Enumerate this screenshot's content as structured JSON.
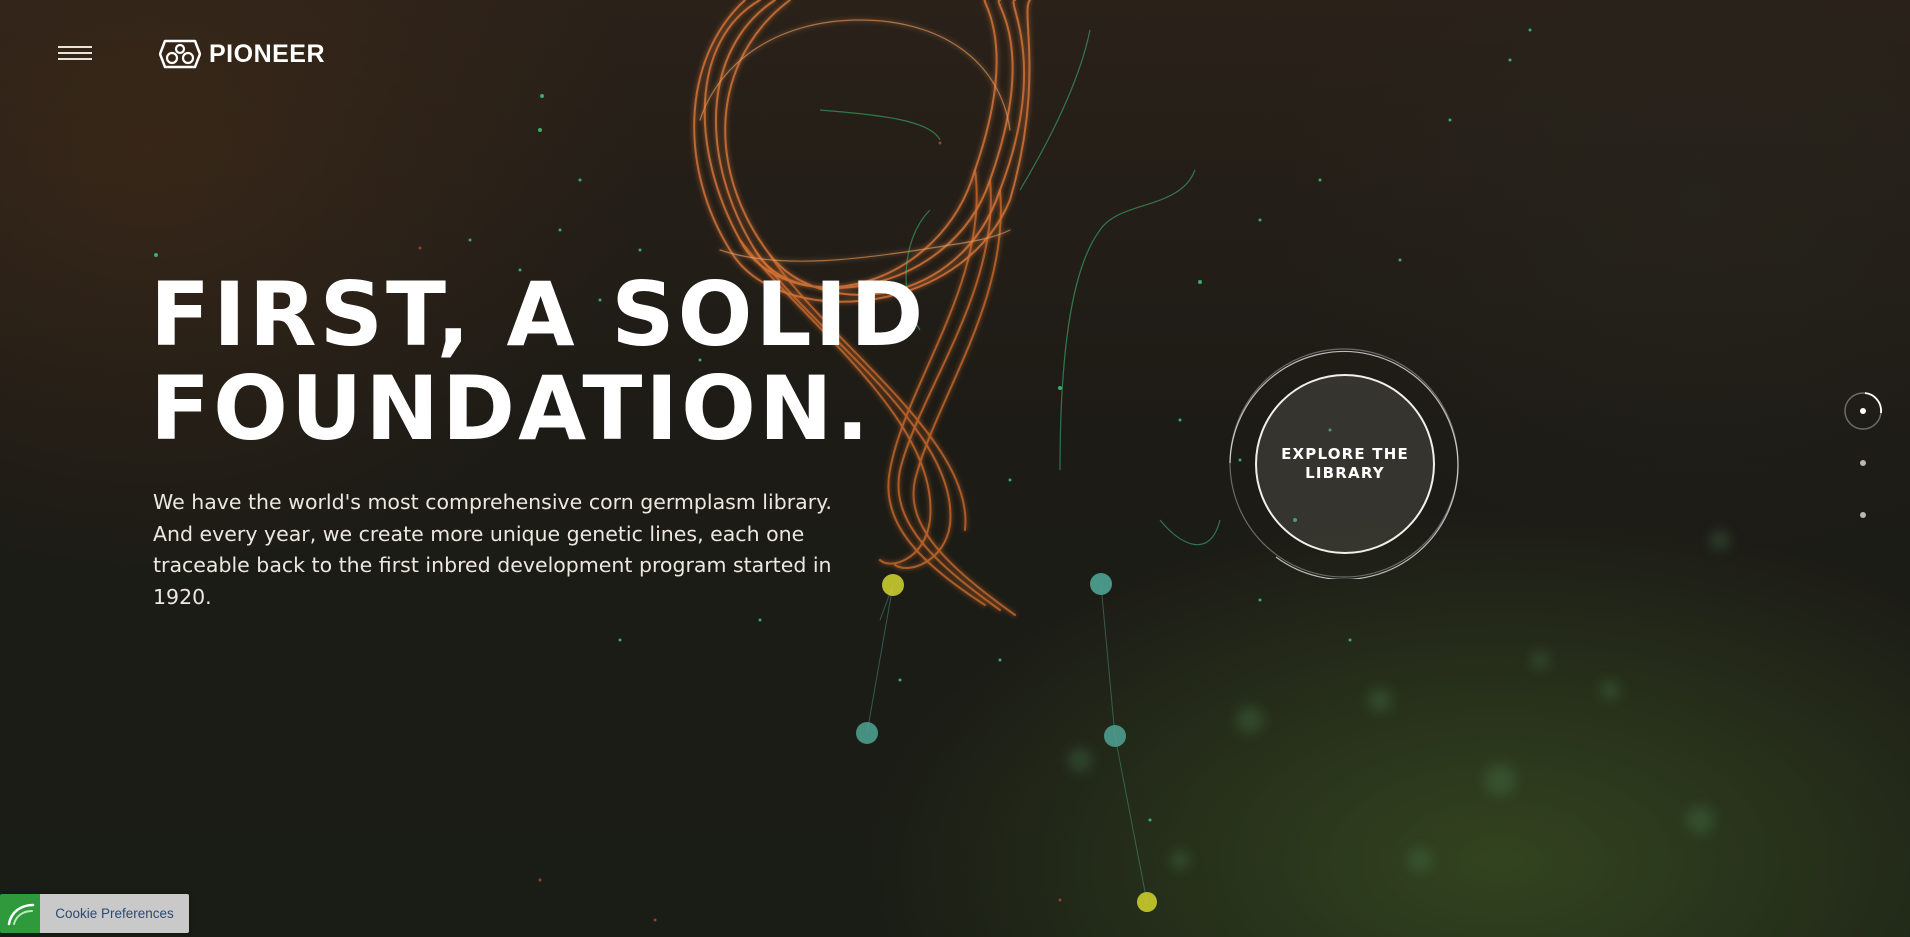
{
  "header": {
    "menu_icon": "hamburger-menu-icon",
    "logo_text": "PIONEER",
    "logo_icon": "pioneer-emblem-icon"
  },
  "hero": {
    "headline_line1": "FIRST, A SOLID",
    "headline_line2": "FOUNDATION.",
    "body": "We have the world's most comprehensive corn germplasm library. And every year, we create more unique genetic lines, each one traceable back to the first inbred development program started in 1920."
  },
  "cta": {
    "explore_label": "EXPLORE THE LIBRARY"
  },
  "pager": {
    "total": 3,
    "active_index": 0
  },
  "cookie": {
    "label": "Cookie Preferences",
    "icon": "cookie-leaf-icon"
  },
  "colors": {
    "accent_orange": "#e8894a",
    "accent_green": "#3fbf74",
    "node_yellow": "#c9cc2e",
    "node_teal": "#4fa394",
    "cookie_green": "#2e9a3c"
  }
}
